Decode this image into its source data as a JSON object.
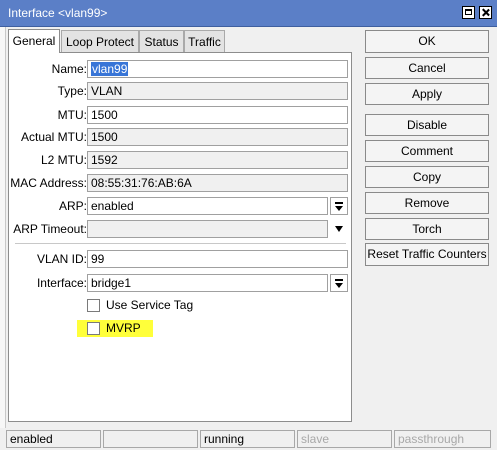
{
  "window": {
    "title": "Interface <vlan99>"
  },
  "tabs": [
    {
      "label": "General",
      "active": true
    },
    {
      "label": "Loop Protect",
      "active": false
    },
    {
      "label": "Status",
      "active": false
    },
    {
      "label": "Traffic",
      "active": false
    }
  ],
  "fields": {
    "name": {
      "label": "Name:",
      "value": "vlan99"
    },
    "type": {
      "label": "Type:",
      "value": "VLAN"
    },
    "mtu": {
      "label": "MTU:",
      "value": "1500"
    },
    "actual_mtu": {
      "label": "Actual MTU:",
      "value": "1500"
    },
    "l2_mtu": {
      "label": "L2 MTU:",
      "value": "1592"
    },
    "mac_address": {
      "label": "MAC Address:",
      "value": "08:55:31:76:AB:6A"
    },
    "arp": {
      "label": "ARP:",
      "value": "enabled"
    },
    "arp_timeout": {
      "label": "ARP Timeout:",
      "value": ""
    },
    "vlan_id": {
      "label": "VLAN ID:",
      "value": "99"
    },
    "interface": {
      "label": "Interface:",
      "value": "bridge1"
    }
  },
  "checkboxes": {
    "use_service_tag": {
      "label": "Use Service Tag",
      "checked": false
    },
    "mvrp": {
      "label": "MVRP",
      "checked": false,
      "highlight_color": "#ffff3a"
    }
  },
  "buttons": {
    "ok": "OK",
    "cancel": "Cancel",
    "apply": "Apply",
    "disable": "Disable",
    "comment": "Comment",
    "copy": "Copy",
    "remove": "Remove",
    "torch": "Torch",
    "reset_traffic_counters": "Reset Traffic Counters"
  },
  "status_bar": {
    "seg1": "enabled",
    "seg2": "",
    "seg3": "running",
    "seg4": "slave",
    "seg5": "passthrough"
  },
  "colors": {
    "titlebar": "#5b7fc7",
    "selection": "#3875d7",
    "highlight": "#ffff3a"
  }
}
